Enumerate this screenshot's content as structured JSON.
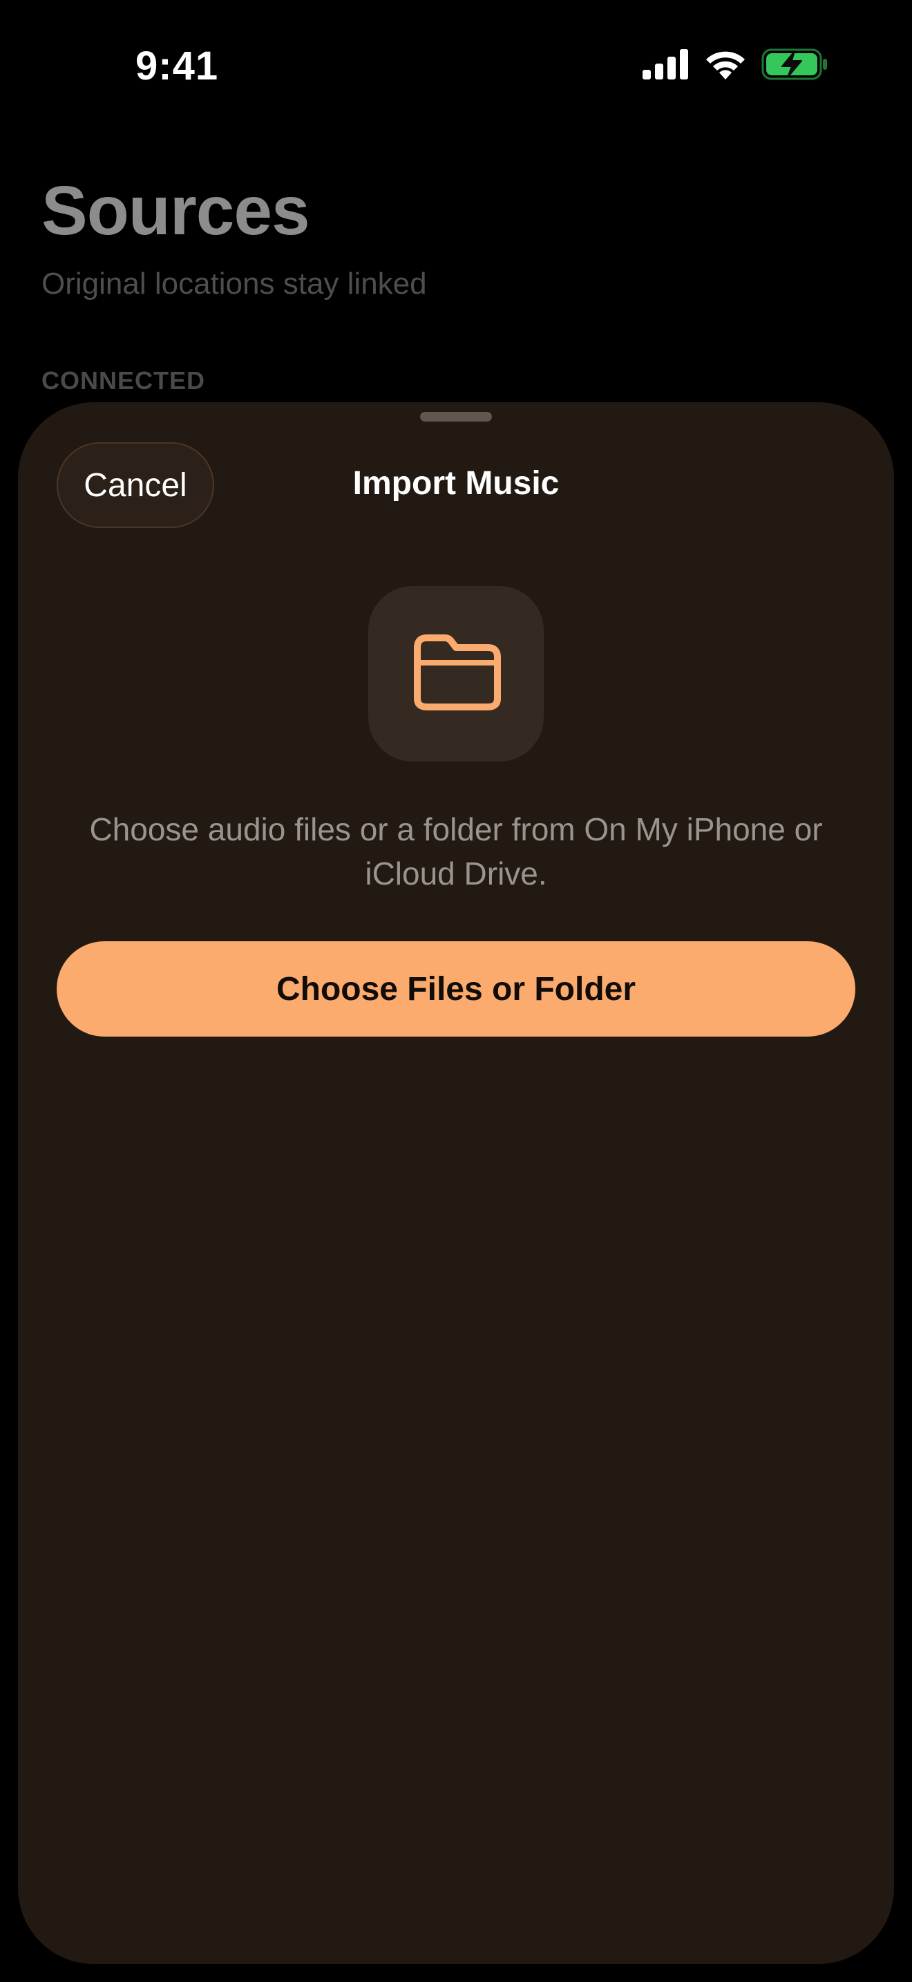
{
  "status_bar": {
    "time": "9:41",
    "icons": [
      "cellular-signal-icon",
      "wifi-icon",
      "battery-charging-icon"
    ],
    "battery_color": "#34c759"
  },
  "background_page": {
    "title": "Sources",
    "subtitle": "Original locations stay linked",
    "section_header": "CONNECTED"
  },
  "sheet": {
    "cancel_label": "Cancel",
    "title": "Import Music",
    "icon": "folder-icon",
    "description": "Choose audio files or a folder from On My iPhone or iCloud Drive.",
    "primary_button_label": "Choose Files or Folder",
    "accent_color": "#fcab6e",
    "background_color": "#221912"
  }
}
